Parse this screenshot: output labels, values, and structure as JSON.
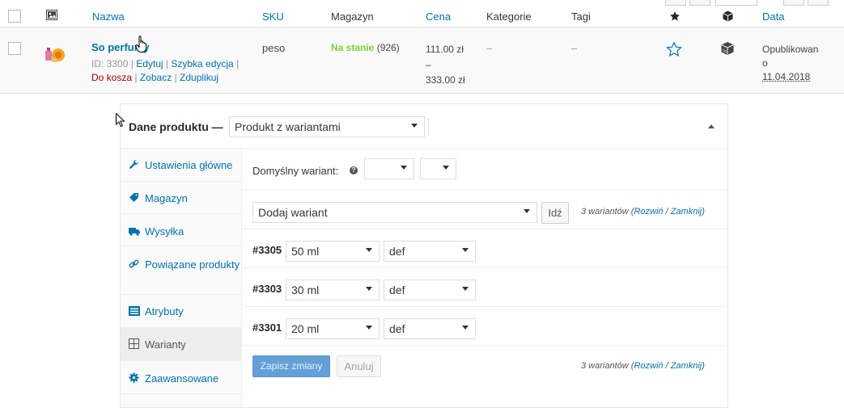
{
  "table": {
    "headers": {
      "name": "Nazwa",
      "sku": "SKU",
      "stock": "Magazyn",
      "price": "Cena",
      "categories": "Kategorie",
      "tags": "Tagi",
      "date": "Data"
    },
    "row": {
      "name": "So perfumy",
      "id_label": "ID: 3300",
      "sep": "|",
      "edit": "Edytuj",
      "quick_edit": "Szybka edycja",
      "trash": "Do kosza",
      "view": "Zobacz",
      "duplicate": "Zduplikuj",
      "sku": "peso",
      "stock_status": "Na stanie",
      "stock_count": "(926)",
      "price_from": "111.00 zł",
      "price_dash": "–",
      "price_to": "333.00 zł",
      "categories": "–",
      "tags": "–",
      "date_status_1": "Opublikowan",
      "date_status_2": "o",
      "date": "11.04.2018"
    }
  },
  "product_data": {
    "title": "Dane produktu —",
    "type_value": "Produkt z wariantami",
    "tabs": [
      {
        "label": "Ustawienia główne",
        "icon": "wrench-icon"
      },
      {
        "label": "Magazyn",
        "icon": "tag-icon"
      },
      {
        "label": "Wysyłka",
        "icon": "truck-icon"
      },
      {
        "label": "Powiązane produkty",
        "icon": "link-icon"
      },
      {
        "label": "Atrybuty",
        "icon": "list-icon"
      },
      {
        "label": "Warianty",
        "icon": "grid-icon"
      },
      {
        "label": "Zaawansowane",
        "icon": "gear-icon"
      }
    ],
    "default_variant_label": "Domyślny wariant:",
    "add_variant_value": "Dodaj wariant",
    "go_button": "Idź",
    "variant_count_text": "3 wariantów",
    "expand": "Rozwiń",
    "slash": "/",
    "collapse": "Zamknij",
    "variants": [
      {
        "id": "#3305",
        "size": "50 ml",
        "second": "def"
      },
      {
        "id": "#3303",
        "size": "30 ml",
        "second": "def"
      },
      {
        "id": "#3301",
        "size": "20 ml",
        "second": "def"
      }
    ],
    "save_button": "Zapisz zmiany",
    "cancel_button": "Anuluj"
  },
  "colors": {
    "link": "#0073aa",
    "in_stock": "#7ad03a",
    "trash": "#aa0000",
    "primary_button": "#64a0d8"
  }
}
